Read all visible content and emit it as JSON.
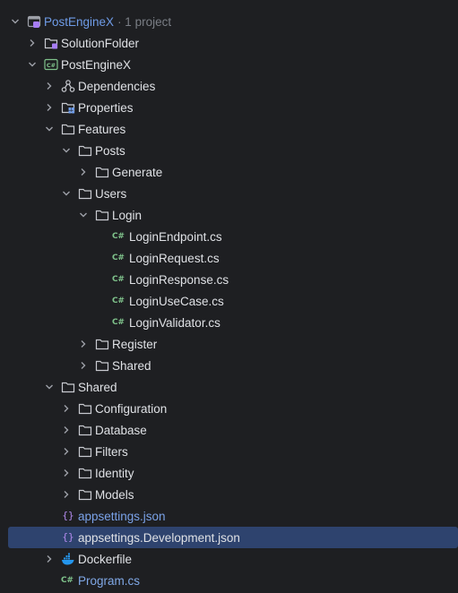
{
  "tree": {
    "root": {
      "label": "PostEngineX",
      "suffix": "· 1 project"
    },
    "items": [
      {
        "label": "SolutionFolder"
      },
      {
        "label": "PostEngineX"
      },
      {
        "label": "Dependencies"
      },
      {
        "label": "Properties"
      },
      {
        "label": "Features"
      },
      {
        "label": "Posts"
      },
      {
        "label": "Generate"
      },
      {
        "label": "Users"
      },
      {
        "label": "Login"
      },
      {
        "label": "LoginEndpoint.cs"
      },
      {
        "label": "LoginRequest.cs"
      },
      {
        "label": "LoginResponse.cs"
      },
      {
        "label": "LoginUseCase.cs"
      },
      {
        "label": "LoginValidator.cs"
      },
      {
        "label": "Register"
      },
      {
        "label": "Shared"
      },
      {
        "label": "Shared"
      },
      {
        "label": "Configuration"
      },
      {
        "label": "Database"
      },
      {
        "label": "Filters"
      },
      {
        "label": "Identity"
      },
      {
        "label": "Models"
      },
      {
        "label": "appsettings.json"
      },
      {
        "label": "appsettings.Development.json"
      },
      {
        "label": "Dockerfile"
      },
      {
        "label": "Program.cs"
      }
    ]
  },
  "icons": {
    "cs_glyph": "C#",
    "json_glyph": "{}"
  },
  "colors": {
    "background": "#1e1f22",
    "selection": "#2e436e",
    "text": "#dfe1e5",
    "link_blue": "#6f9ce8",
    "csharp_green": "#7fc28b",
    "json_purple": "#b58cf0",
    "docker_blue": "#2496ed"
  }
}
